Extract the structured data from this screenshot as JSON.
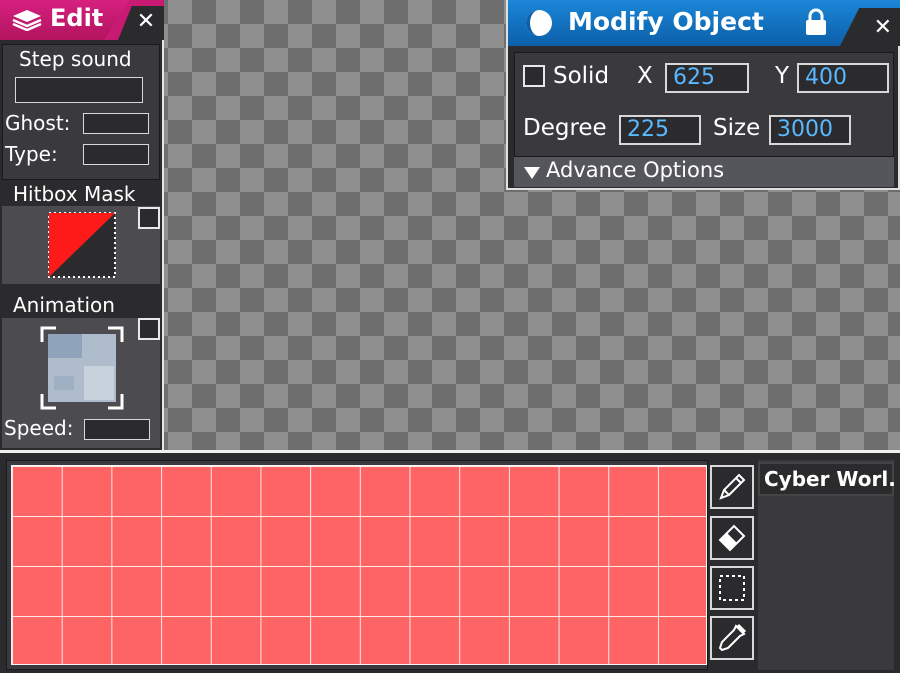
{
  "edit_panel": {
    "title": "Edit",
    "step_sound_label": "Step sound",
    "step_sound_value": "",
    "ghost_label": "Ghost:",
    "ghost_value": "",
    "type_label": "Type:",
    "type_value": "",
    "hitbox_label": "Hitbox Mask",
    "animation_label": "Animation",
    "speed_label": "Speed:",
    "speed_value": ""
  },
  "modify_panel": {
    "title": "Modify Object",
    "solid_label": "Solid",
    "x_label": "X",
    "x_value": "625",
    "y_label": "Y",
    "y_value": "400",
    "degree_label": "Degree",
    "degree_value": "225",
    "size_label": "Size",
    "size_value": "3000",
    "advance_label": "Advance Options"
  },
  "tileset": {
    "name": "Cyber Worl."
  },
  "colors": {
    "edit_accent": "#c81a73",
    "modify_accent": "#1b86d8",
    "tile_fill": "#ff6464",
    "value_text": "#5ab8ff",
    "hitbox_red": "#ff1a1a"
  },
  "icons": {
    "edit": "layers-icon",
    "modify": "moon-icon",
    "lock": "lock-icon",
    "tools": [
      "pencil-icon",
      "eraser-icon",
      "selection-icon",
      "eyedropper-icon"
    ]
  }
}
